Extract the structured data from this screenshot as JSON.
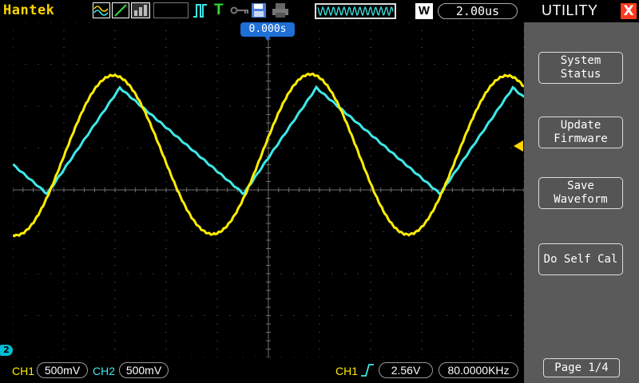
{
  "colors": {
    "ch1": "#ffee00",
    "ch2": "#3ee8e8",
    "brand": "#ffd400",
    "marker": "#1e6fd6",
    "close": "#ff3b1f",
    "grid": "#6e6e6e"
  },
  "header": {
    "brand": "Hantek",
    "icons": [
      "math-wave-icon",
      "line-icon",
      "dots-icon",
      "trigger-edge-icon",
      "t-icon",
      "key-icon",
      "save-disk-icon",
      "printer-icon"
    ],
    "t_label": "T",
    "w_label": "W",
    "timebase": "2.00us"
  },
  "screen": {
    "horizontal_position": "0.000s",
    "ch2_marker": "2"
  },
  "panel": {
    "title": "UTILITY",
    "close_label": "X",
    "buttons": [
      {
        "label": "System Status"
      },
      {
        "label": "Update Firmware"
      },
      {
        "label": "Save Waveform"
      },
      {
        "label": "Do Self Cal"
      }
    ],
    "page": "Page 1/4"
  },
  "footer": {
    "ch1_label": "CH1",
    "ch1_scale": "500mV",
    "ch2_label": "CH2",
    "ch2_scale": "500mV",
    "trigger_source": "CH1",
    "trigger_level": "2.56V",
    "frequency": "80.0000KHz"
  }
}
